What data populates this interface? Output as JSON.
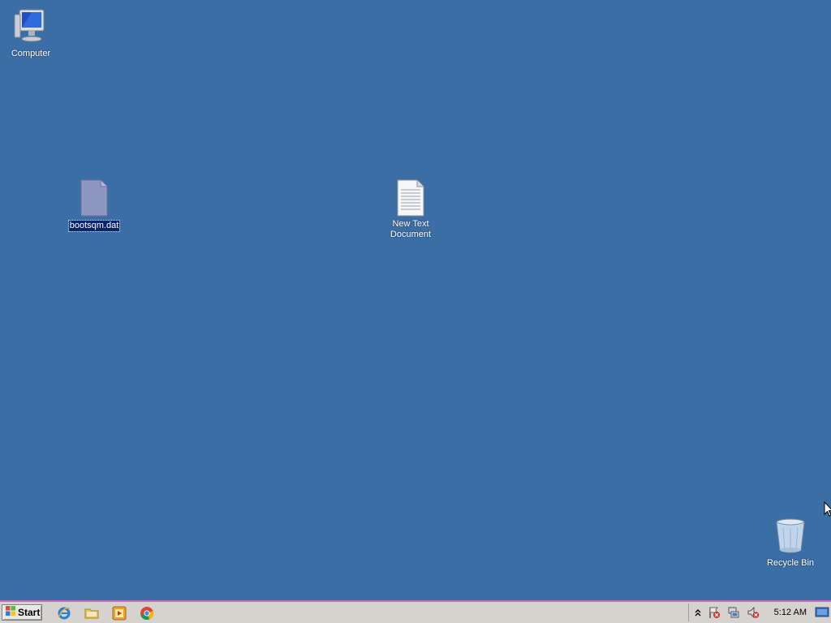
{
  "desktop": {
    "icons": [
      {
        "label": "Computer",
        "icon": "computer-icon"
      },
      {
        "label": "bootsqm.dat",
        "icon": "file-icon",
        "selected": true
      },
      {
        "label": "New Text Document",
        "icon": "text-document-icon"
      },
      {
        "label": "Recycle Bin",
        "icon": "recycle-bin-icon"
      }
    ]
  },
  "taskbar": {
    "start_label": "Start",
    "quick_launch": [
      "internet-explorer-icon",
      "folder-icon",
      "media-player-icon",
      "chrome-icon"
    ],
    "tray": {
      "icons": [
        "show-hidden-icons-chevron",
        "action-center-flag-icon",
        "network-icon",
        "volume-muted-icon",
        "show-desktop-icon"
      ],
      "clock": "5:12 AM"
    }
  },
  "colors": {
    "desktop_background": "#3c6ea6",
    "taskbar": "#d6d3ce",
    "selection": "#0a246a"
  }
}
